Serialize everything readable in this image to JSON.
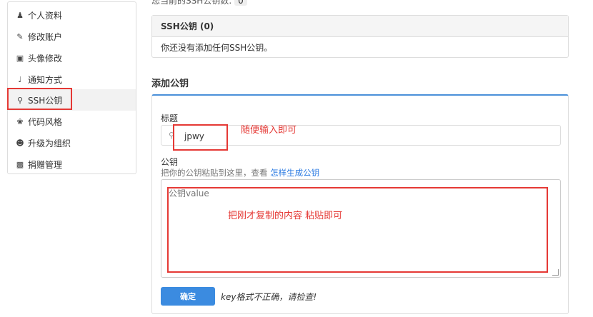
{
  "sidebar": {
    "items": [
      {
        "label": "个人资料",
        "icon": "user-icon"
      },
      {
        "label": "修改账户",
        "icon": "pencil-icon"
      },
      {
        "label": "头像修改",
        "icon": "picture-icon"
      },
      {
        "label": "通知方式",
        "icon": "speaker-icon"
      },
      {
        "label": "SSH公钥",
        "icon": "key-icon",
        "active": true
      },
      {
        "label": "代码风格",
        "icon": "palette-icon"
      },
      {
        "label": "升级为组织",
        "icon": "group-icon"
      },
      {
        "label": "捐赠管理",
        "icon": "gift-icon"
      }
    ]
  },
  "top_line": {
    "text": "您当前的SSH公钥数:",
    "count": "0"
  },
  "ssh_panel": {
    "title": "SSH公钥 (0)",
    "empty_text": "你还没有添加任何SSH公钥。"
  },
  "add_section": {
    "title": "添加公钥"
  },
  "form": {
    "title_label": "标题",
    "title_value": "jpwy",
    "key_label": "公钥",
    "key_hint": "把你的公钥粘贴到这里，查看",
    "key_hint_link": "怎样生成公钥",
    "key_placeholder": "公钥value",
    "submit_label": "确定",
    "error_text": "key格式不正确，请检查!"
  },
  "annotations": {
    "title_note": "随便输入即可",
    "key_note": "把刚才复制的内容 粘贴即可"
  },
  "colors": {
    "accent": "#3b8be0",
    "annotation": "#e53935"
  }
}
